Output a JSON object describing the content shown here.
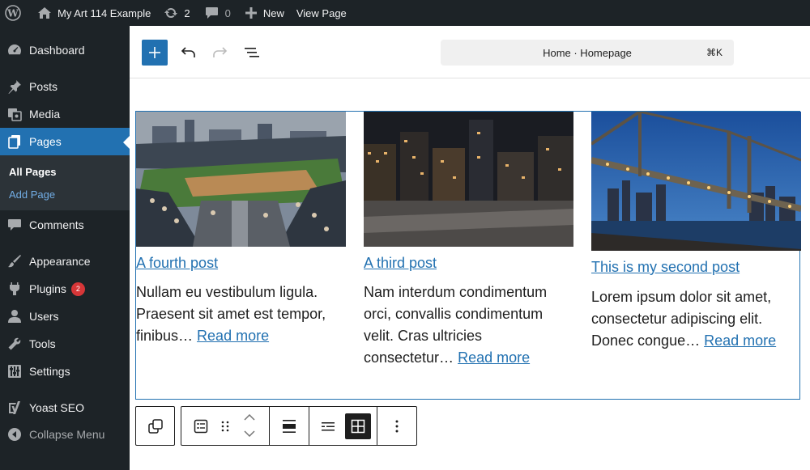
{
  "adminbar": {
    "site_name": "My Art 114 Example",
    "updates_count": "2",
    "comments_count": "0",
    "new_label": "New",
    "view_page_label": "View Page"
  },
  "sidebar": {
    "items": [
      {
        "label": "Dashboard",
        "icon": "dashboard-icon"
      },
      {
        "label": "Posts",
        "icon": "pin-icon"
      },
      {
        "label": "Media",
        "icon": "media-icon"
      },
      {
        "label": "Pages",
        "icon": "pages-icon",
        "active": true
      },
      {
        "label": "Comments",
        "icon": "comment-icon"
      },
      {
        "label": "Appearance",
        "icon": "brush-icon"
      },
      {
        "label": "Plugins",
        "icon": "plug-icon",
        "badge": "2"
      },
      {
        "label": "Users",
        "icon": "user-icon"
      },
      {
        "label": "Tools",
        "icon": "wrench-icon"
      },
      {
        "label": "Settings",
        "icon": "settings-icon"
      },
      {
        "label": "Yoast SEO",
        "icon": "yoast-icon"
      }
    ],
    "submenu": {
      "all_pages": "All Pages",
      "add_page": "Add Page"
    },
    "collapse_label": "Collapse Menu"
  },
  "editor": {
    "command_bar": {
      "label": "Home · Homepage",
      "shortcut": "⌘K"
    }
  },
  "posts": [
    {
      "title": "A fourth post",
      "excerpt": "Nullam eu vestibulum ligula. Praesent sit amet est tempor, finibus…",
      "read_more": "Read more",
      "image": "baseball-stadium"
    },
    {
      "title": "A third post",
      "excerpt": "Nam interdum condimentum orci, convallis condimentum velit. Cras ultricies consectetur…",
      "read_more": "Read more",
      "image": "city-night"
    },
    {
      "title": "This is my second post",
      "excerpt": "Lorem ipsum dolor sit amet, consectetur adipiscing elit. Donec congue…",
      "read_more": "Read more",
      "image": "bridge-dusk"
    }
  ],
  "colors": {
    "admin_dark": "#1d2327",
    "accent": "#2271b1",
    "badge": "#d63638"
  }
}
